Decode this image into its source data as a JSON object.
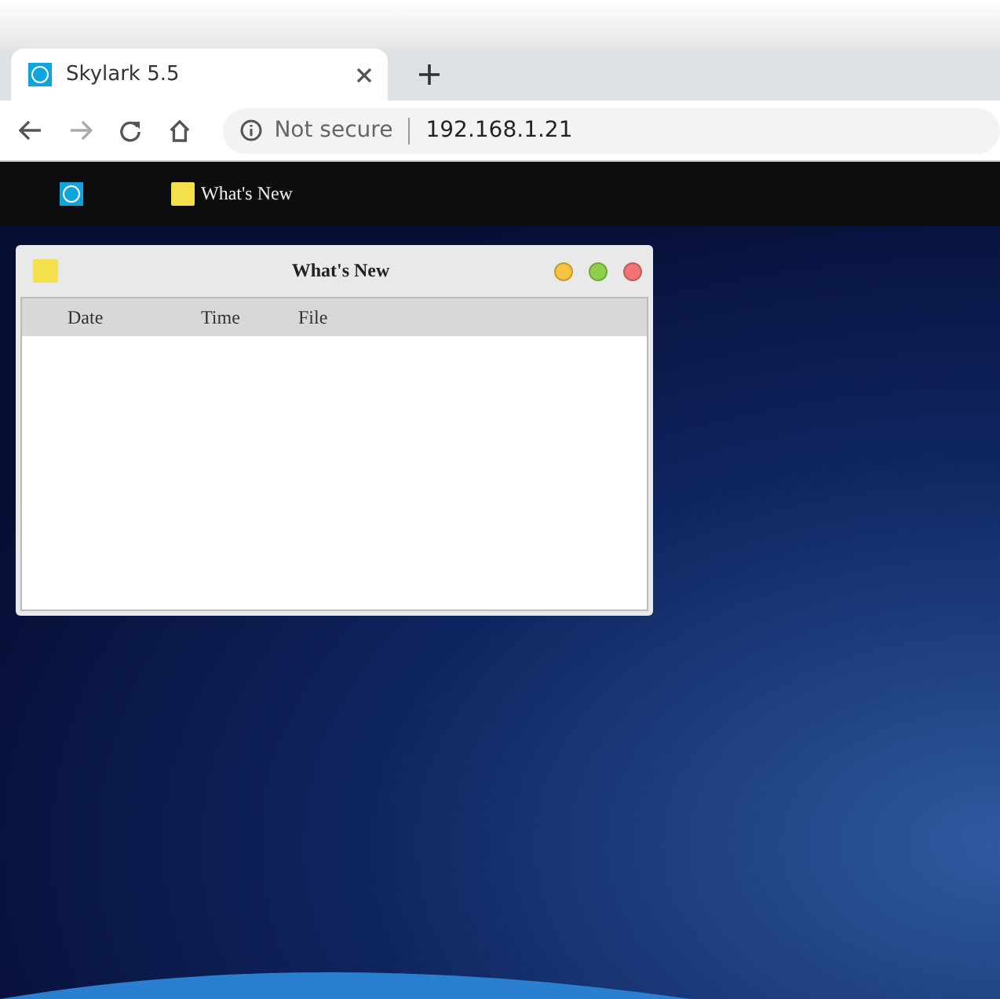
{
  "browser": {
    "tab": {
      "title": "Skylark 5.5",
      "selected": true
    },
    "security_label": "Not secure",
    "url": "192.168.1.21"
  },
  "taskbar": {
    "items": [
      {
        "kind": "launcher"
      },
      {
        "kind": "app",
        "label": "What's New"
      }
    ]
  },
  "window": {
    "title": "What's New",
    "table": {
      "columns": [
        {
          "label": "Date"
        },
        {
          "label": "Time"
        },
        {
          "label": "File"
        }
      ]
    }
  }
}
